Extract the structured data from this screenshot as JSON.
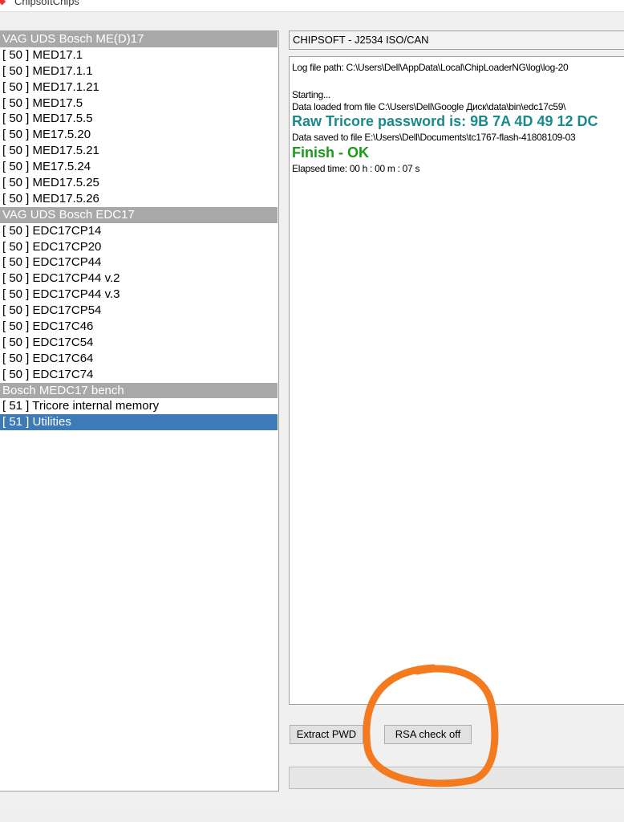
{
  "window": {
    "title": "ChipsoftChips",
    "app_icon": "app-icon"
  },
  "device_list": [
    {
      "label": "VAG UDS Bosch ME(D)17",
      "kind": "header"
    },
    {
      "label": "[ 50 ] MED17.1",
      "kind": "item"
    },
    {
      "label": "[ 50 ] MED17.1.1",
      "kind": "item"
    },
    {
      "label": "[ 50 ] MED17.1.21",
      "kind": "item"
    },
    {
      "label": "[ 50 ] MED17.5",
      "kind": "item"
    },
    {
      "label": "[ 50 ] MED17.5.5",
      "kind": "item"
    },
    {
      "label": "[ 50 ] ME17.5.20",
      "kind": "item"
    },
    {
      "label": "[ 50 ] MED17.5.21",
      "kind": "item"
    },
    {
      "label": "[ 50 ] ME17.5.24",
      "kind": "item"
    },
    {
      "label": "[ 50 ] MED17.5.25",
      "kind": "item"
    },
    {
      "label": "[ 50 ] MED17.5.26",
      "kind": "item"
    },
    {
      "label": "VAG UDS Bosch EDC17",
      "kind": "header"
    },
    {
      "label": "[ 50 ] EDC17CP14",
      "kind": "item"
    },
    {
      "label": "[ 50 ] EDC17CP20",
      "kind": "item"
    },
    {
      "label": "[ 50 ] EDC17CP44",
      "kind": "item"
    },
    {
      "label": "[ 50 ] EDC17CP44 v.2",
      "kind": "item"
    },
    {
      "label": "[ 50 ] EDC17CP44 v.3",
      "kind": "item"
    },
    {
      "label": "[ 50 ] EDC17CP54",
      "kind": "item"
    },
    {
      "label": "[ 50 ] EDC17C46",
      "kind": "item"
    },
    {
      "label": "[ 50 ] EDC17C54",
      "kind": "item"
    },
    {
      "label": "[ 50 ] EDC17C64",
      "kind": "item"
    },
    {
      "label": "[ 50 ] EDC17C74",
      "kind": "item"
    },
    {
      "label": "Bosch MEDC17 bench",
      "kind": "header"
    },
    {
      "label": "[ 51 ] Tricore internal memory",
      "kind": "item"
    },
    {
      "label": "[ 51 ] Utilities",
      "kind": "selected"
    }
  ],
  "connection": {
    "label": "CHIPSOFT - J2534 ISO/CAN"
  },
  "log": {
    "path": "Log file path: C:\\Users\\Dell\\AppData\\Local\\ChipLoaderNG\\log\\log-20",
    "starting": "Starting...",
    "loaded": "Data loaded from file C:\\Users\\Dell\\Google Диск\\data\\bin\\edc17c59\\",
    "password": "Raw Tricore password is: 9B 7A 4D 49 12 DC",
    "saved": "Data saved to file E:\\Users\\Dell\\Documents\\tc1767-flash-41808109-03",
    "finish": "Finish - OK",
    "elapsed": "Elapsed time: 00 h : 00 m : 07 s"
  },
  "buttons": {
    "extract_pwd": "Extract PWD",
    "rsa_check_off": "RSA check off"
  },
  "progress": {
    "fraction": 0
  },
  "colors": {
    "list_header_bg": "#a8a8a8",
    "selected_bg": "#3d7ab8",
    "password_text": "#1b8a8a",
    "finish_text": "#1a9a1a",
    "annotation": "#f47a20"
  }
}
